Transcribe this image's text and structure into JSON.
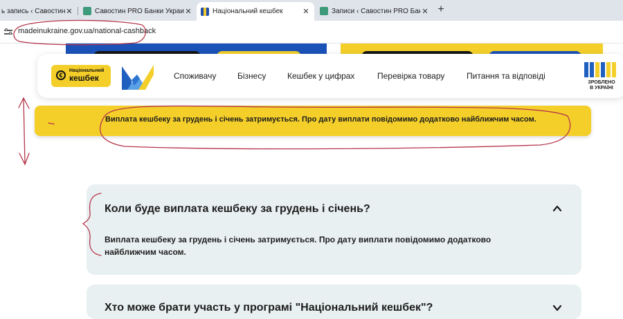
{
  "browser": {
    "tabs": [
      {
        "title": "ь запись ‹ Савостин PRO",
        "favicon": "green-tab-icon"
      },
      {
        "title": "Савостин PRO Банки Украины",
        "favicon": "green-tab-icon"
      },
      {
        "title": "Національний кешбек",
        "favicon": "ukraine-flag-tab-icon"
      },
      {
        "title": "Записи ‹ Савостин PRO Банки...",
        "favicon": "green-tab-icon"
      }
    ],
    "close_glyph": "✕",
    "new_tab_glyph": "+",
    "url": "madeinukraine.gov.ua/national-cashback"
  },
  "header": {
    "logo_line1": "Національний",
    "logo_line2": "кешбек",
    "logo_symbol": "€",
    "nav": [
      "Споживачу",
      "Бізнесу",
      "Кешбек у цифрах",
      "Перевірка товару",
      "Питання та відповіді"
    ],
    "made_line1": "ЗРОБЛЕНО",
    "made_line2": "В УКРАЇНІ"
  },
  "banner": {
    "text": "Виплата кешбеку за грудень і січень затримується. Про дату виплати повідомимо додатково найближчим часом."
  },
  "faq": [
    {
      "question": "Коли буде виплата кешбеку за грудень і січень?",
      "answer_line1": "Виплата кешбеку за грудень і січень затримується. Про дату виплати повідомимо додатково",
      "answer_line2": "найближчим часом.",
      "expanded": true
    },
    {
      "question": "Хто може брати участь у програмі \"Національний кешбек\"?",
      "expanded": false
    }
  ],
  "colors": {
    "brand_yellow": "#f4cf2a",
    "brand_blue": "#1a52b8",
    "accordion_bg": "#e9f0f1",
    "annotation_red": "#b5344a"
  }
}
